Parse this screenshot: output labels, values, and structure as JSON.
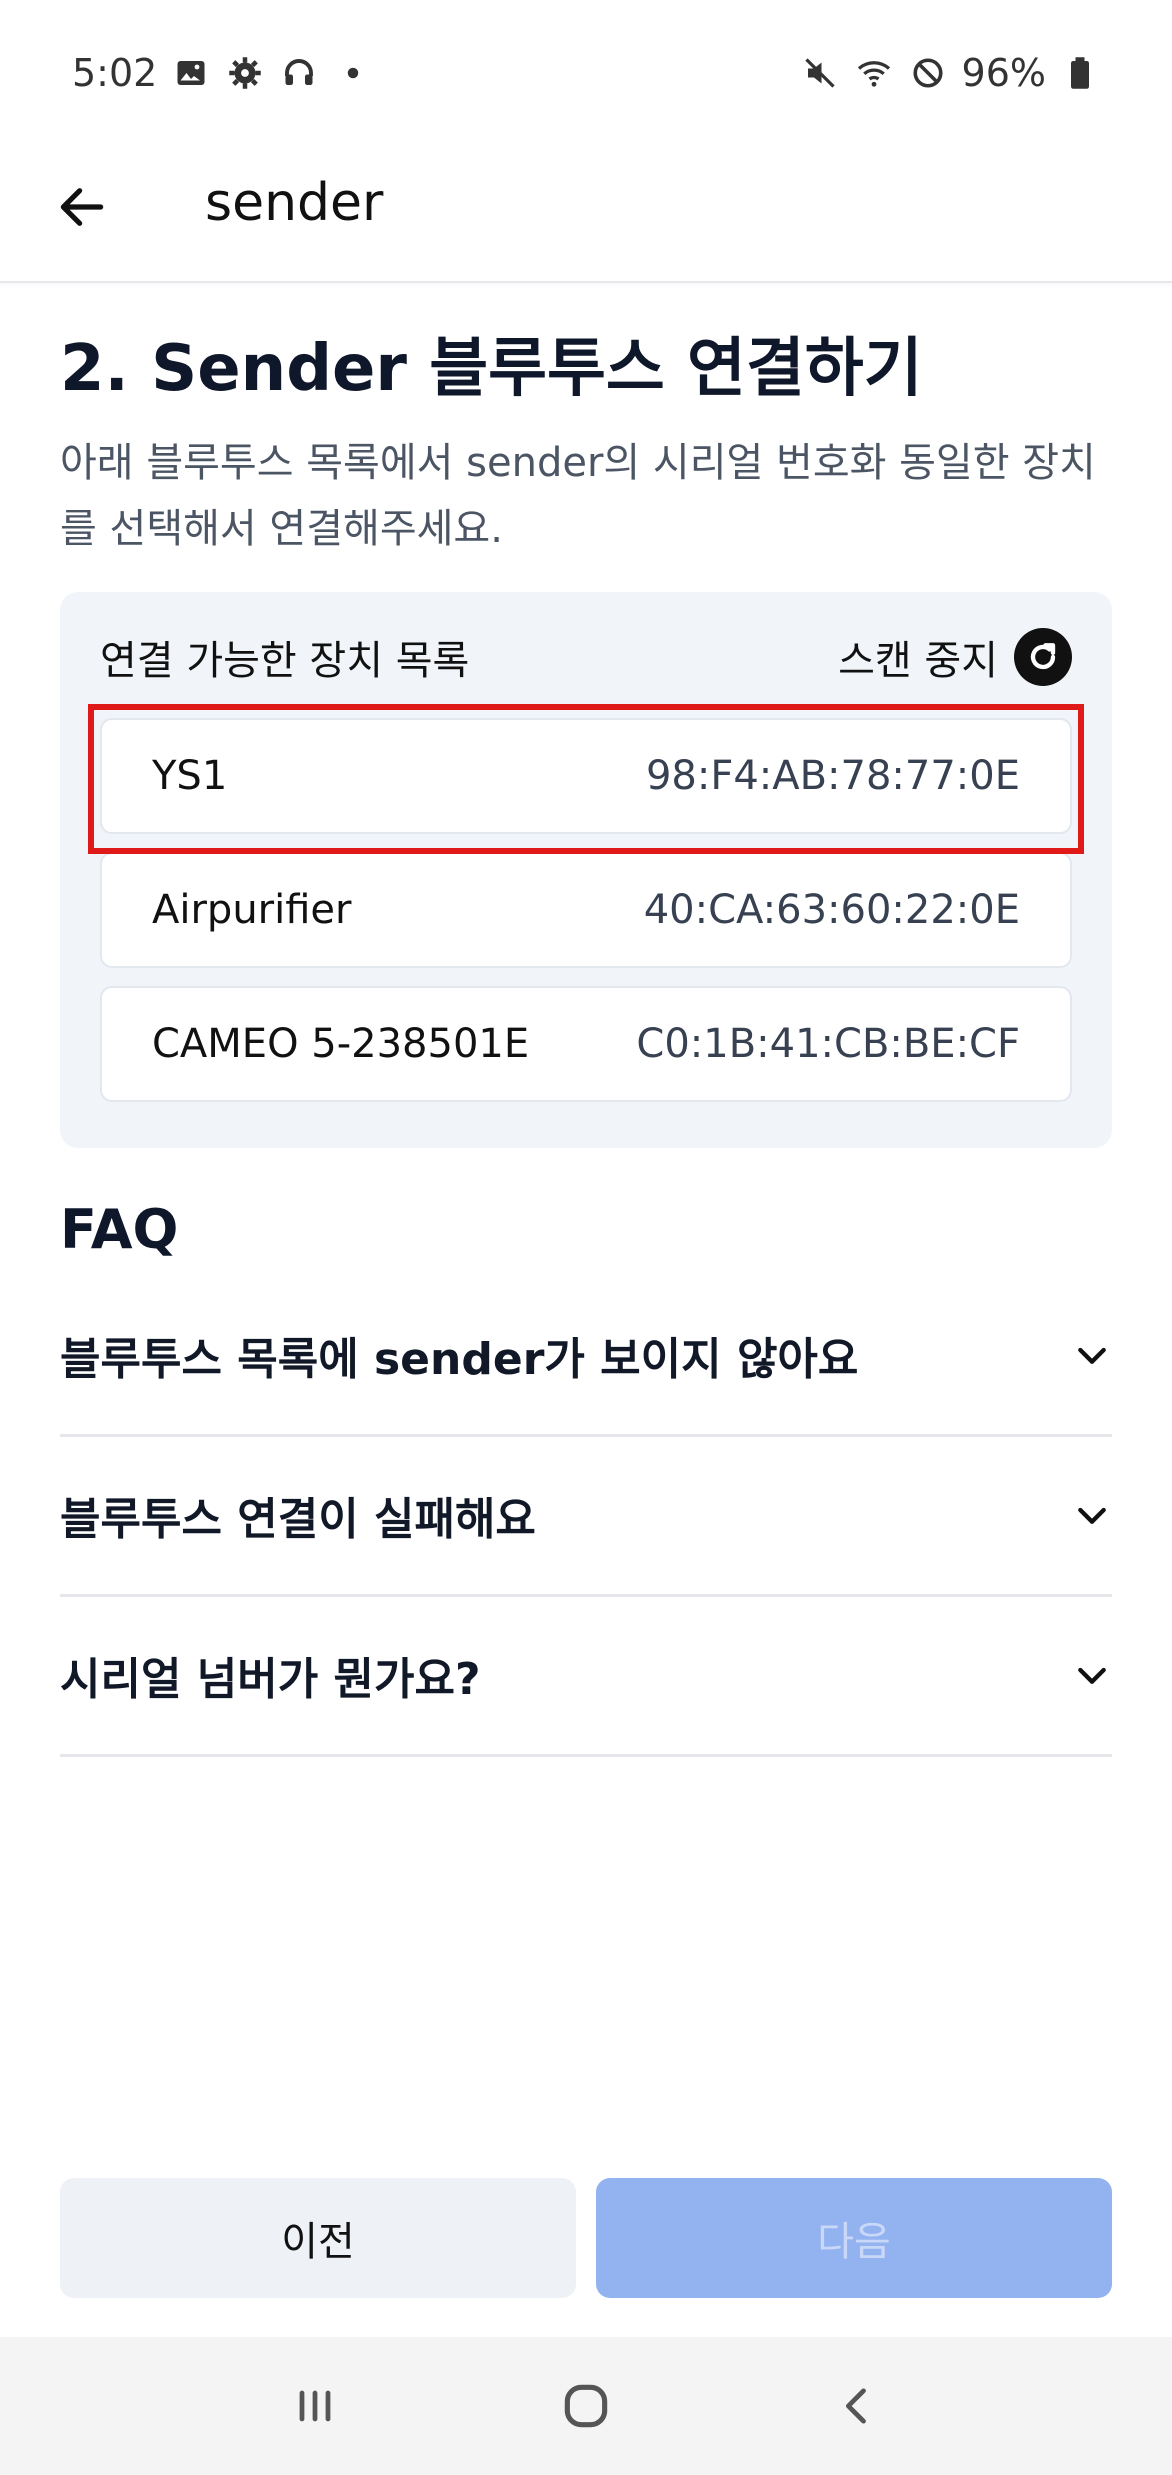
{
  "status_bar": {
    "time": "5:02",
    "battery": "96%",
    "left_icons": [
      "gallery-icon",
      "settings-gear-icon",
      "headphones-icon",
      "dot-icon"
    ],
    "right_icons": [
      "vibrate-mute-icon",
      "wifi-icon",
      "do-not-disturb-icon",
      "battery-icon"
    ]
  },
  "app_bar": {
    "title": "sender"
  },
  "page": {
    "heading": "2. Sender 블루투스 연결하기",
    "description": "아래 블루투스 목록에서 sender의 시리얼 번호화 동일한 장치를 선택해서 연결해주세요."
  },
  "device_panel": {
    "title": "연결 가능한 장치 목록",
    "scan_stop_label": "스캔 중지",
    "devices": [
      {
        "name": "YS1",
        "mac": "98:F4:AB:78:77:0E"
      },
      {
        "name": "Airpurifier",
        "mac": "40:CA:63:60:22:0E"
      },
      {
        "name": "CAMEO 5-238501E",
        "mac": "C0:1B:41:CB:BE:CF"
      }
    ],
    "highlight_color": "#e01919"
  },
  "faq": {
    "title": "FAQ",
    "items": [
      {
        "question": "블루투스 목록에 sender가 보이지 않아요"
      },
      {
        "question": "블루투스 연결이 실패해요"
      },
      {
        "question": "시리얼 넘버가 뭔가요?"
      }
    ]
  },
  "buttons": {
    "prev_label": "이전",
    "next_label": "다음",
    "next_color": "#93b2f0"
  },
  "nav_bar": {
    "icons": [
      "recent-apps-icon",
      "home-icon",
      "back-nav-icon"
    ]
  }
}
